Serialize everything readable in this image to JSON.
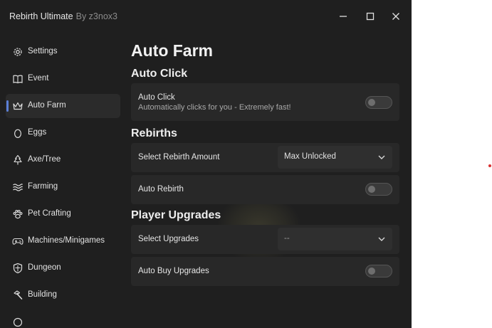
{
  "window": {
    "title": "Rebirth Ultimate",
    "subtitle": "By z3nox3",
    "controls": [
      "minimize-icon",
      "maximize-icon",
      "close-icon"
    ]
  },
  "sidebar": {
    "items": [
      {
        "label": "Settings",
        "icon": "gear-icon",
        "active": false
      },
      {
        "label": "Event",
        "icon": "book-icon",
        "active": false
      },
      {
        "label": "Auto Farm",
        "icon": "crown-icon",
        "active": true
      },
      {
        "label": "Eggs",
        "icon": "egg-icon",
        "active": false
      },
      {
        "label": "Axe/Tree",
        "icon": "tree-icon",
        "active": false
      },
      {
        "label": "Farming",
        "icon": "waves-icon",
        "active": false
      },
      {
        "label": "Pet Crafting",
        "icon": "paw-icon",
        "active": false
      },
      {
        "label": "Machines/Minigames",
        "icon": "gamepad-icon",
        "active": false
      },
      {
        "label": "Dungeon",
        "icon": "shield-icon",
        "active": false
      },
      {
        "label": "Building",
        "icon": "hammer-icon",
        "active": false
      }
    ]
  },
  "main": {
    "page_title": "Auto Farm",
    "auto_click": {
      "section_title": "Auto Click",
      "toggle_label": "Auto Click",
      "toggle_description": "Automatically clicks for you - Extremely fast!",
      "enabled": false
    },
    "rebirths": {
      "section_title": "Rebirths",
      "amount_label": "Select Rebirth Amount",
      "amount_value": "Max Unlocked",
      "auto_label": "Auto Rebirth",
      "auto_enabled": false
    },
    "upgrades": {
      "section_title": "Player Upgrades",
      "select_label": "Select Upgrades",
      "select_value": "--",
      "auto_label": "Auto Buy Upgrades",
      "auto_enabled": false
    }
  },
  "colors": {
    "window_bg": "#1f1f1f",
    "card_bg": "#282828",
    "accent": "#5b7fd6",
    "text": "#e6e6e6",
    "muted_text": "#a8a8a8"
  }
}
